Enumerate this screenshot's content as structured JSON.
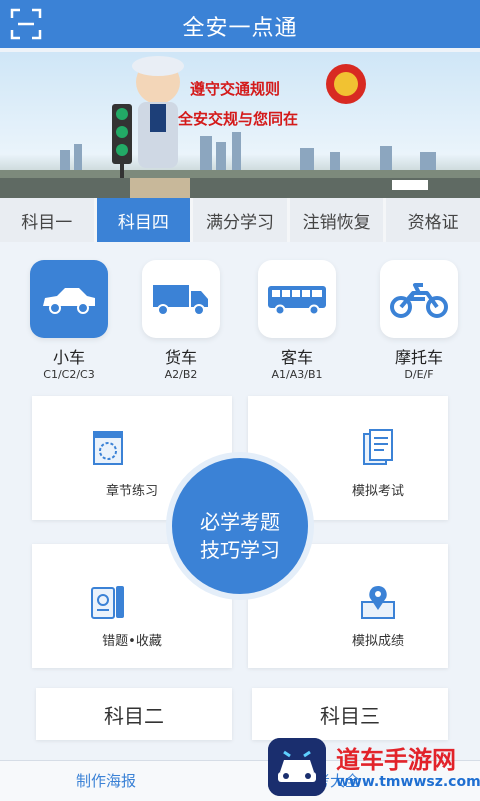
{
  "header": {
    "title": "全安一点通"
  },
  "banner": {
    "line1": "遵守交通规则",
    "line2": "全安交规与您同在"
  },
  "tabs": [
    {
      "label": "科目一",
      "active": false
    },
    {
      "label": "科目四",
      "active": true
    },
    {
      "label": "满分学习",
      "active": false
    },
    {
      "label": "注销恢复",
      "active": false
    },
    {
      "label": "资格证",
      "active": false
    }
  ],
  "vehicles": [
    {
      "name": "小车",
      "sub": "C1/C2/C3",
      "icon": "car-icon",
      "active": true
    },
    {
      "name": "货车",
      "sub": "A2/B2",
      "icon": "truck-icon",
      "active": false
    },
    {
      "name": "客车",
      "sub": "A1/A3/B1",
      "icon": "bus-icon",
      "active": false
    },
    {
      "name": "摩托车",
      "sub": "D/E/F",
      "icon": "motorcycle-icon",
      "active": false
    }
  ],
  "features": {
    "chapter": "章节练习",
    "mock_exam": "模拟考试",
    "mistakes": "错题•收藏",
    "mock_score": "模拟成绩",
    "center_line1": "必学考题",
    "center_line2": "技巧学习"
  },
  "subjects": {
    "left": "科目二",
    "right": "科目三"
  },
  "bottom": {
    "left": "制作海报",
    "right": "驾考大全"
  },
  "watermark": {
    "name": "道车手游网",
    "url": "www.tmwwsz.com"
  },
  "colors": {
    "primary": "#3b82d6",
    "background": "#eef3f9",
    "watermark_red": "#e2232a"
  }
}
